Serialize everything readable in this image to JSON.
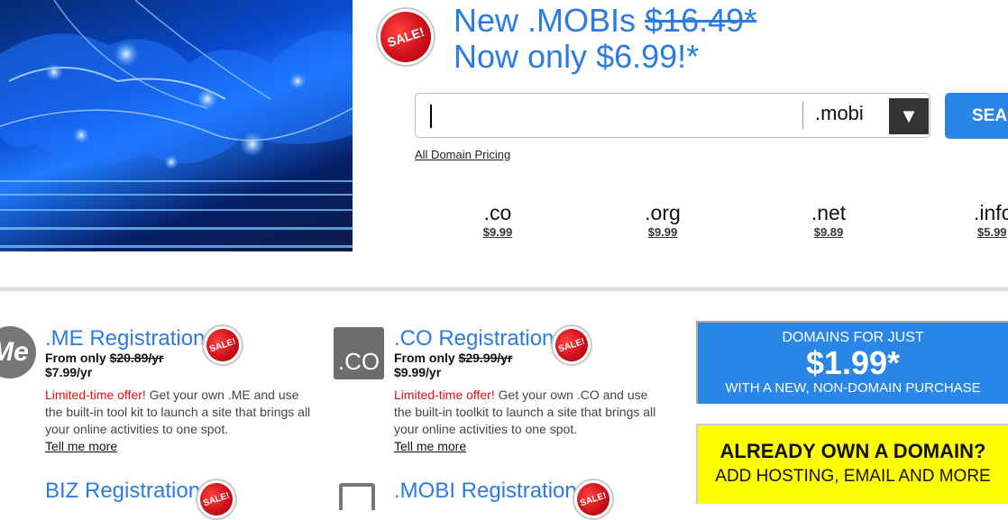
{
  "hero": {
    "alt": "glowing world map network graphic"
  },
  "headline": {
    "line1_prefix": "New .MOBIs ",
    "line1_old_price": "$16.49*",
    "line2": "Now only $6.99!*"
  },
  "sale_badge": {
    "text": "SALE!"
  },
  "search": {
    "input_value": "",
    "tld_selected": ".mobi",
    "dropdown_arrow": "▼",
    "button_label": "SEA"
  },
  "pricing_link": "All Domain Pricing",
  "tlds": [
    {
      "name": ".co",
      "price": "$9.99"
    },
    {
      "name": ".org",
      "price": "$9.99"
    },
    {
      "name": ".net",
      "price": "$9.89"
    },
    {
      "name": ".info",
      "price": "$5.99"
    }
  ],
  "cards": [
    {
      "icon_text": "Me",
      "title": ".ME Registration",
      "from_label": "From only ",
      "old_price": "$20.89/yr",
      "new_price": "$7.99/yr",
      "offer": "Limited-time offer!",
      "desc": " Get your own .ME and use the built-in tool kit to launch a site that brings all your online activities to one spot.",
      "more": "Tell me more"
    },
    {
      "icon_text": ".CO",
      "title": ".CO Registration",
      "from_label": "From only ",
      "old_price": "$29.99/yr",
      "new_price": "$9.99/yr",
      "offer": "Limited-time offer!",
      "desc": " Get your own .CO and use the built-in toolkit to launch a site that brings all your online activities to one spot.",
      "more": "Tell me more"
    },
    {
      "title": "BIZ Registration"
    },
    {
      "title": ".MOBI Registration"
    }
  ],
  "promo_blue": {
    "line1": "DOMAINS FOR JUST",
    "price": "$1.99*",
    "line3": "WITH A NEW, NON-DOMAIN PURCHASE"
  },
  "promo_yellow": {
    "line1": "ALREADY OWN A DOMAIN?",
    "line2": "ADD HOSTING, EMAIL AND MORE"
  },
  "colors": {
    "accent_blue": "#2a7be2",
    "sale_red": "#d0101a",
    "offer_red": "#e01010",
    "promo_yellow": "#ffff00"
  }
}
